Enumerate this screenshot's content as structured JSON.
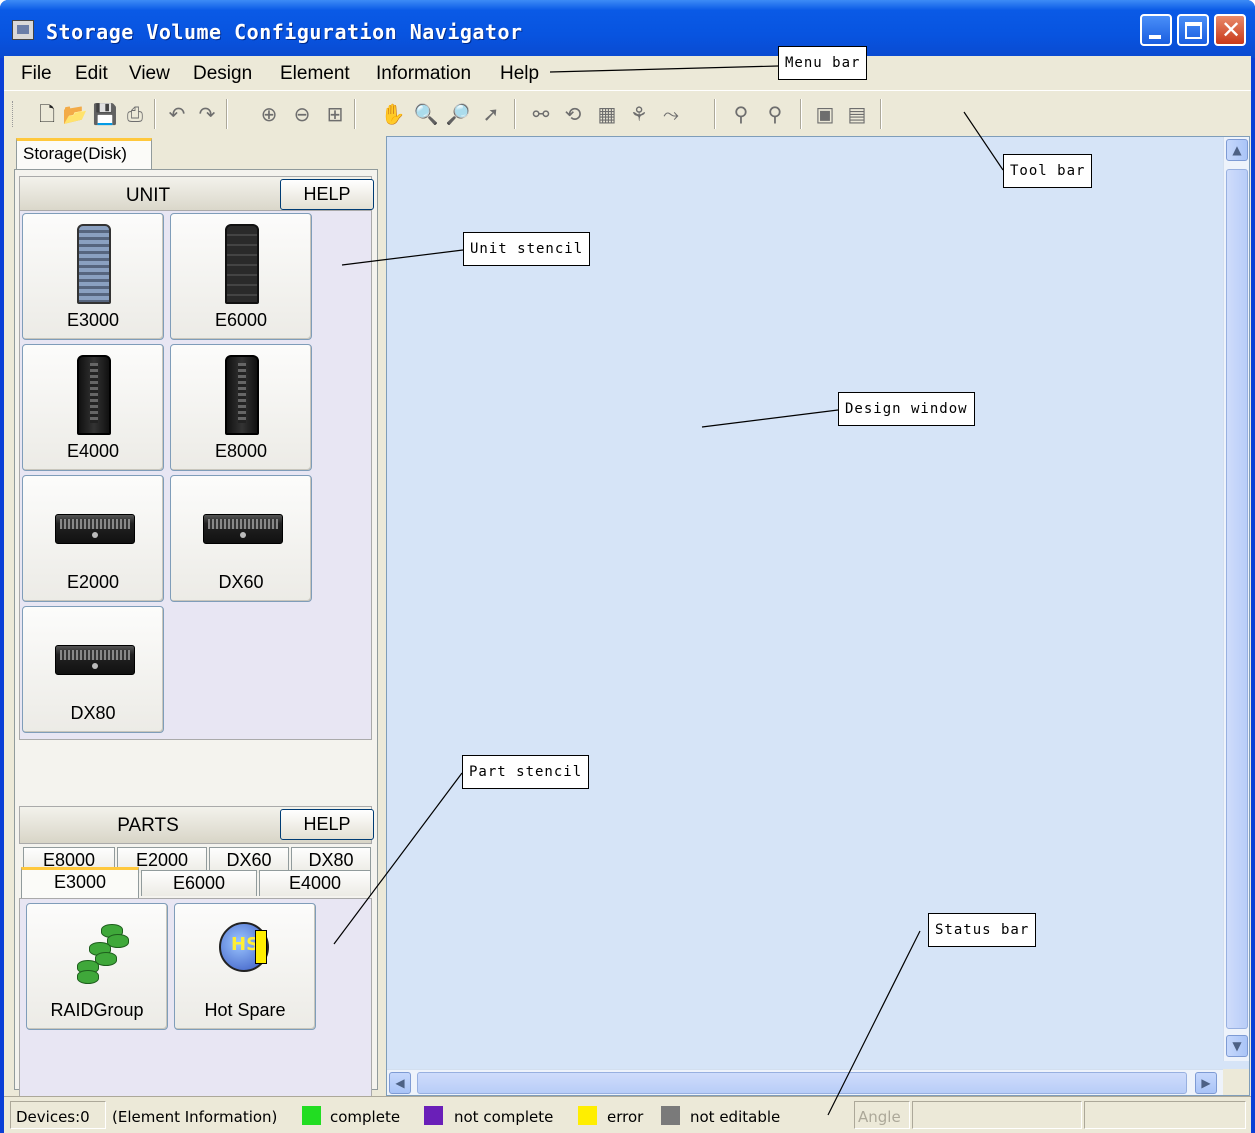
{
  "window": {
    "title": "Storage Volume Configuration Navigator"
  },
  "menu": {
    "items": [
      {
        "name": "file",
        "label": "File"
      },
      {
        "name": "edit",
        "label": "Edit"
      },
      {
        "name": "view",
        "label": "View"
      },
      {
        "name": "design",
        "label": "Design"
      },
      {
        "name": "element",
        "label": "Element"
      },
      {
        "name": "information",
        "label": "Information"
      },
      {
        "name": "help",
        "label": "Help"
      }
    ]
  },
  "toolbar": {
    "icons": [
      "new-file-icon",
      "open-folder-icon",
      "save-icon",
      "print-icon",
      "undo-icon",
      "redo-icon",
      "zoom-in-icon",
      "zoom-out-icon",
      "fit-window-icon",
      "hand-pan-icon",
      "zoom-area-icon",
      "zoom-select-icon",
      "pointer-icon",
      "layout-icon",
      "rotate-icon",
      "grid-icon",
      "tree-icon",
      "connect-icon",
      "hierarchy-icon",
      "hierarchy-alt-icon",
      "export-icon",
      "import-icon"
    ]
  },
  "left": {
    "tab": "Storage(Disk)",
    "unit": {
      "header": "UNIT",
      "help": "HELP",
      "items": [
        {
          "label": "E3000"
        },
        {
          "label": "E6000"
        },
        {
          "label": "E4000"
        },
        {
          "label": "E8000"
        },
        {
          "label": "E2000"
        },
        {
          "label": "DX60"
        },
        {
          "label": "DX80"
        }
      ]
    },
    "parts": {
      "header": "PARTS",
      "help": "HELP",
      "tabs_back": [
        "E8000",
        "E2000",
        "DX60",
        "DX80"
      ],
      "tabs_front": [
        "E3000",
        "E6000",
        "E4000"
      ],
      "selected_tab": "E3000",
      "items": [
        {
          "label": "RAIDGroup"
        },
        {
          "label": "Hot Spare"
        }
      ]
    }
  },
  "status": {
    "devices": "Devices:0",
    "element_info": "(Element Information)",
    "legend": [
      {
        "label": "complete",
        "color": "#22dd22"
      },
      {
        "label": "not complete",
        "color": "#6a1fb8"
      },
      {
        "label": "error",
        "color": "#ffee00"
      },
      {
        "label": "not editable",
        "color": "#7a7a7a"
      }
    ],
    "angle": "Angle"
  },
  "callouts": {
    "menu_bar": "Menu bar",
    "tool_bar": "Tool bar",
    "unit_stencil": "Unit stencil",
    "design_window": "Design window",
    "part_stencil": "Part stencil",
    "status_bar": "Status bar"
  }
}
